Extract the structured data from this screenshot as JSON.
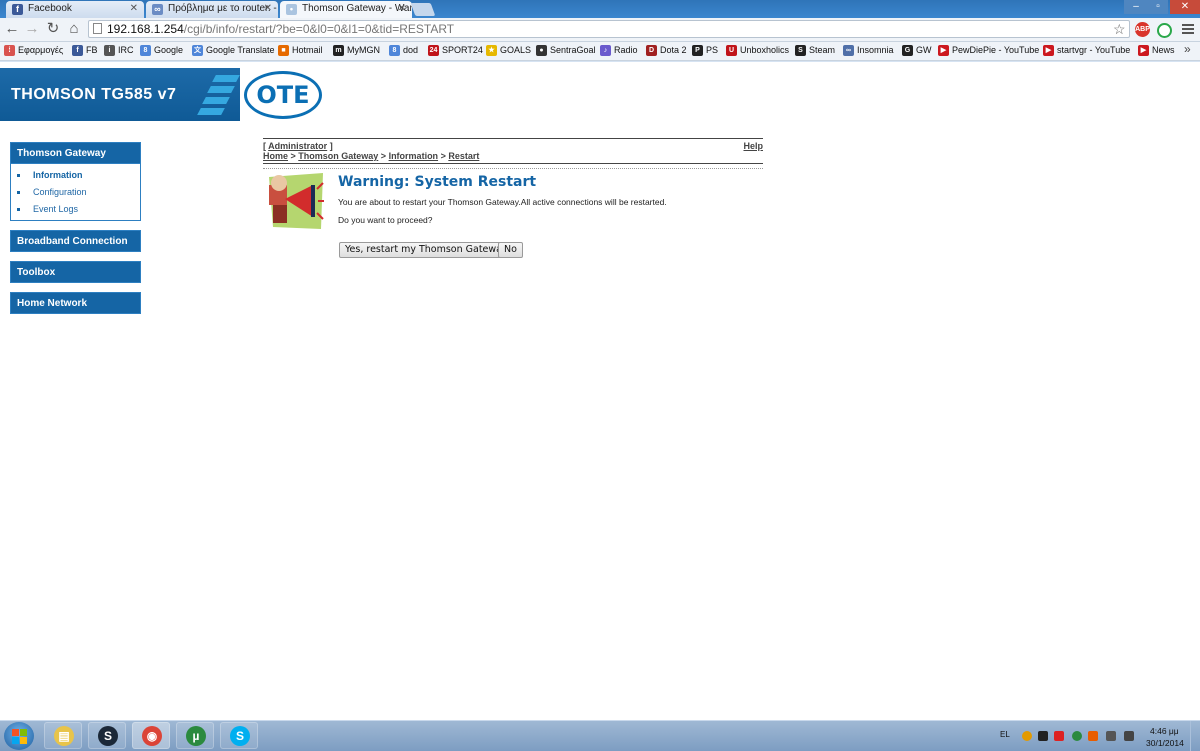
{
  "browser": {
    "tabs": [
      {
        "title": "Facebook",
        "icon": "facebook-icon",
        "color": "#3b5998",
        "glyph": "f"
      },
      {
        "title": "Πρόβλημα με το router. -",
        "icon": "forum-icon",
        "color": "#6b8cc4",
        "glyph": "∞"
      },
      {
        "title": "Thomson Gateway - Warn",
        "icon": "thomson-icon",
        "color": "#aac4e0",
        "glyph": "•"
      }
    ],
    "url_host": "192.168.1.254",
    "url_path": "/cgi/b/info/restart/?be=0&l0=0&l1=0&tid=RESTART",
    "bookmarks": [
      {
        "label": "Εφαρμογές",
        "icon": "apps-icon",
        "color": "#d9534f",
        "glyph": "⁞"
      },
      {
        "label": "FB",
        "icon": "facebook-icon",
        "color": "#3b5998",
        "glyph": "f"
      },
      {
        "label": "IRC",
        "icon": "irc-icon",
        "color": "#555",
        "glyph": "i"
      },
      {
        "label": "Google",
        "icon": "google-icon",
        "color": "#4f86d9",
        "glyph": "8"
      },
      {
        "label": "Google Translate",
        "icon": "translate-icon",
        "color": "#4f86d9",
        "glyph": "文"
      },
      {
        "label": "Hotmail",
        "icon": "windows-icon",
        "color": "#e66a00",
        "glyph": "■"
      },
      {
        "label": "MyMGN",
        "icon": "mgn-icon",
        "color": "#222",
        "glyph": "m"
      },
      {
        "label": "dod",
        "icon": "google-icon",
        "color": "#4f86d9",
        "glyph": "8"
      },
      {
        "label": "SPORT24",
        "icon": "sport24-icon",
        "color": "#c0141a",
        "glyph": "24"
      },
      {
        "label": "GOALS",
        "icon": "goals-icon",
        "color": "#e6b800",
        "glyph": "★"
      },
      {
        "label": "SentraGoal",
        "icon": "ball-icon",
        "color": "#333",
        "glyph": "●"
      },
      {
        "label": "Radio",
        "icon": "radio-icon",
        "color": "#6a5acd",
        "glyph": "♪"
      },
      {
        "label": "Dota 2",
        "icon": "dota-icon",
        "color": "#a02020",
        "glyph": "D"
      },
      {
        "label": "PS",
        "icon": "playstation-icon",
        "color": "#222",
        "glyph": "P"
      },
      {
        "label": "Unboxholics",
        "icon": "unboxholics-icon",
        "color": "#c0141a",
        "glyph": "U"
      },
      {
        "label": "Steam",
        "icon": "steam-icon",
        "color": "#222",
        "glyph": "S"
      },
      {
        "label": "Insomnia",
        "icon": "insomnia-icon",
        "color": "#4f6fa8",
        "glyph": "∞"
      },
      {
        "label": "GW",
        "icon": "gw-icon",
        "color": "#222",
        "glyph": "G"
      },
      {
        "label": "PewDiePie - YouTube",
        "icon": "youtube-icon",
        "color": "#cc181e",
        "glyph": "▶"
      },
      {
        "label": "startvgr - YouTube",
        "icon": "youtube-icon",
        "color": "#cc181e",
        "glyph": "▶"
      },
      {
        "label": "News",
        "icon": "youtube-icon",
        "color": "#cc181e",
        "glyph": "▶"
      }
    ],
    "extensions": [
      {
        "icon": "adblock-icon",
        "color": "#d9342b",
        "glyph": "ABP"
      },
      {
        "icon": "refresh-ext-icon",
        "color": "#2aa84a",
        "glyph": "○"
      }
    ]
  },
  "router": {
    "banner_title": "THOMSON TG585 v7",
    "logo_text": "OTE",
    "sidebar": {
      "sections": [
        {
          "label": "Thomson Gateway",
          "items": [
            "Information",
            "Configuration",
            "Event Logs"
          ]
        },
        {
          "label": "Broadband Connection"
        },
        {
          "label": "Toolbox"
        },
        {
          "label": "Home Network"
        }
      ]
    },
    "user_label": "Administrator",
    "help_label": "Help",
    "breadcrumb": [
      "Home",
      "Thomson Gateway",
      "Information",
      "Restart"
    ],
    "warning_title": "Warning: System Restart",
    "warning_message": "You are about to restart your Thomson Gateway.All active connections will be restarted.",
    "warning_question": "Do you want to proceed?",
    "yes_button": "Yes, restart my Thomson Gateway",
    "no_button": "No"
  },
  "taskbar": {
    "apps": [
      {
        "icon": "explorer-icon",
        "color": "#e8c44a",
        "glyph": "▤"
      },
      {
        "icon": "steam-icon",
        "color": "#1b2838",
        "glyph": "S"
      },
      {
        "icon": "chrome-icon",
        "color": "#db4437",
        "glyph": "◉"
      },
      {
        "icon": "utorrent-icon",
        "color": "#2b8a3e",
        "glyph": "µ"
      },
      {
        "icon": "skype-icon",
        "color": "#00aff0",
        "glyph": "S"
      }
    ],
    "language": "EL",
    "time": "4:46 μμ",
    "date": "30/1/2014"
  }
}
